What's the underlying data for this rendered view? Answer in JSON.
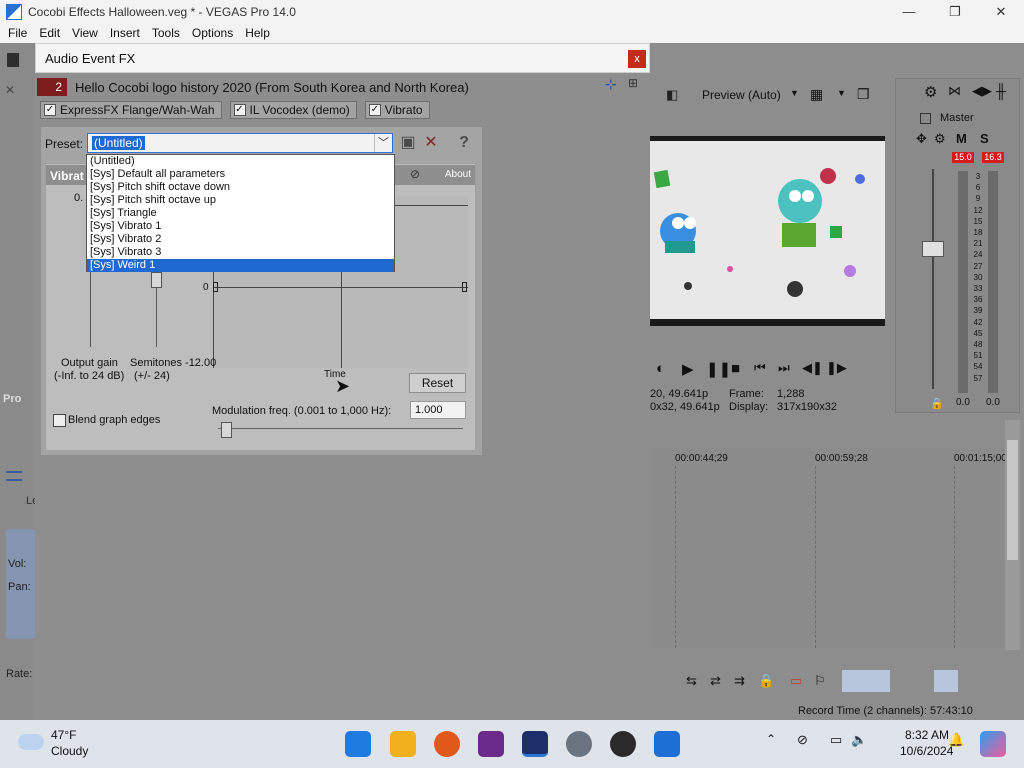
{
  "window": {
    "title": "Cocobi Effects Halloween.veg * - VEGAS Pro 14.0",
    "minimize": "—",
    "maximize": "❐",
    "close": "✕"
  },
  "menu": [
    "File",
    "Edit",
    "View",
    "Insert",
    "Tools",
    "Options",
    "Help"
  ],
  "dialog": {
    "title": "Audio Event FX",
    "close": "x",
    "track_number": "2",
    "event_name": "Hello Cocobi logo history 2020 (From South Korea and North Korea)",
    "chain": [
      {
        "label": "ExpressFX Flange/Wah-Wah",
        "checked": true
      },
      {
        "label": "IL Vocodex (demo)",
        "checked": true
      },
      {
        "label": "Vibrato",
        "checked": true
      }
    ],
    "preset_label": "Preset:",
    "preset_value": "(Untitled)",
    "preset_options": [
      "(Untitled)",
      "[Sys] Default all parameters",
      "[Sys] Pitch shift octave down",
      "[Sys] Pitch shift octave up",
      "[Sys] Triangle",
      "[Sys] Vibrato 1",
      "[Sys] Vibrato 2",
      "[Sys] Vibrato 3",
      "[Sys] Weird 1"
    ],
    "highlighted_option": "[Sys] Weird 1",
    "plugin_name": "Vibrat",
    "about_label": "About",
    "help_glyph": "?",
    "value_top": "0.",
    "graph_zero": "0",
    "output_gain_label": "Output gain",
    "output_gain_range": "(-Inf. to 24 dB)",
    "semitones_label": "Semitones -12.00",
    "semitones_range": "(+/- 24)",
    "time_label": "Time",
    "reset_label": "Reset",
    "blend_label": "Blend graph edges",
    "modfreq_label": "Modulation freq. (0.001 to 1,000 Hz):",
    "modfreq_value": "1.000"
  },
  "preview": {
    "quality": "Preview (Auto)",
    "info_line1": "20, 49.641p",
    "info_line2": "0x32, 49.641p",
    "frame_label": "Frame:",
    "frame_value": "1,288",
    "display_label": "Display:",
    "display_value": "317x190x32"
  },
  "mixer": {
    "master_label": "Master",
    "peak_left": "15.0",
    "peak_right": "16.3",
    "scale": [
      "3",
      "6",
      "9",
      "12",
      "15",
      "18",
      "21",
      "24",
      "27",
      "30",
      "33",
      "36",
      "39",
      "42",
      "45",
      "48",
      "51",
      "54",
      "57"
    ],
    "level_left": "0.0",
    "level_right": "0.0"
  },
  "timeline": {
    "markers": [
      "00:00:44;29",
      "00:00:59;28",
      "00:01:15;00"
    ]
  },
  "left_panel": {
    "tab_label": "Pro",
    "vol_label": "Vol:",
    "pan_label": "Pan:",
    "rate_label": "Rate:",
    "le_label": "Le"
  },
  "status": {
    "record_time": "Record Time (2 channels): 57:43:10"
  },
  "taskbar": {
    "weather_temp": "47°F",
    "weather_desc": "Cloudy",
    "time": "8:32 AM",
    "date": "10/6/2024"
  },
  "colors": {
    "selection_blue": "#1f6ad1",
    "close_red": "#c42b1c",
    "peak_red": "#d81b1b"
  }
}
